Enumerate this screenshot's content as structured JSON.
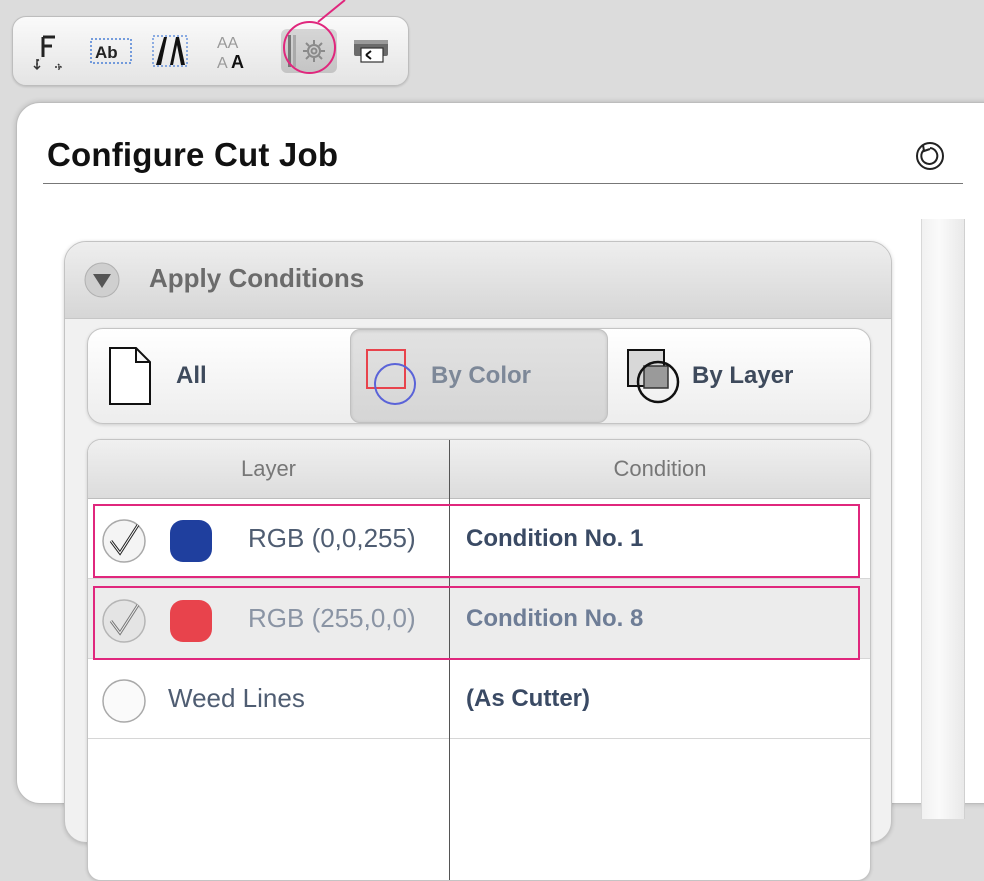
{
  "toolbar": {
    "buttons": [
      {
        "icon": "text-on-path-icon"
      },
      {
        "icon": "text-box-icon"
      },
      {
        "icon": "character-spacing-icon"
      },
      {
        "icon": "font-size-icon"
      },
      {
        "icon": "cut-settings-icon",
        "active": true
      },
      {
        "icon": "send-to-cutter-icon"
      }
    ]
  },
  "panel": {
    "title": "Configure Cut Job",
    "reset_icon": "reset-icon"
  },
  "apply_conditions": {
    "title": "Apply Conditions",
    "modes": [
      {
        "label": "All",
        "icon": "document-icon",
        "selected": false
      },
      {
        "label": "By Color",
        "icon": "color-shapes-icon",
        "selected": true
      },
      {
        "label": "By Layer",
        "icon": "layer-shapes-icon",
        "selected": false
      }
    ],
    "table": {
      "columns": [
        "Layer",
        "Condition"
      ],
      "rows": [
        {
          "checked": true,
          "swatch": "#1f3f9e",
          "layer": "RGB (0,0,255)",
          "condition": "Condition No. 1"
        },
        {
          "checked": true,
          "swatch": "#e8434c",
          "layer": "RGB (255,0,0)",
          "condition": "Condition No. 8",
          "muted": true
        },
        {
          "checked": false,
          "swatch": null,
          "layer": "Weed Lines",
          "condition": "(As Cutter)"
        }
      ]
    }
  },
  "colors": {
    "highlight": "#e0277d",
    "blue_swatch": "#1f3f9e",
    "red_swatch": "#e8434c"
  }
}
